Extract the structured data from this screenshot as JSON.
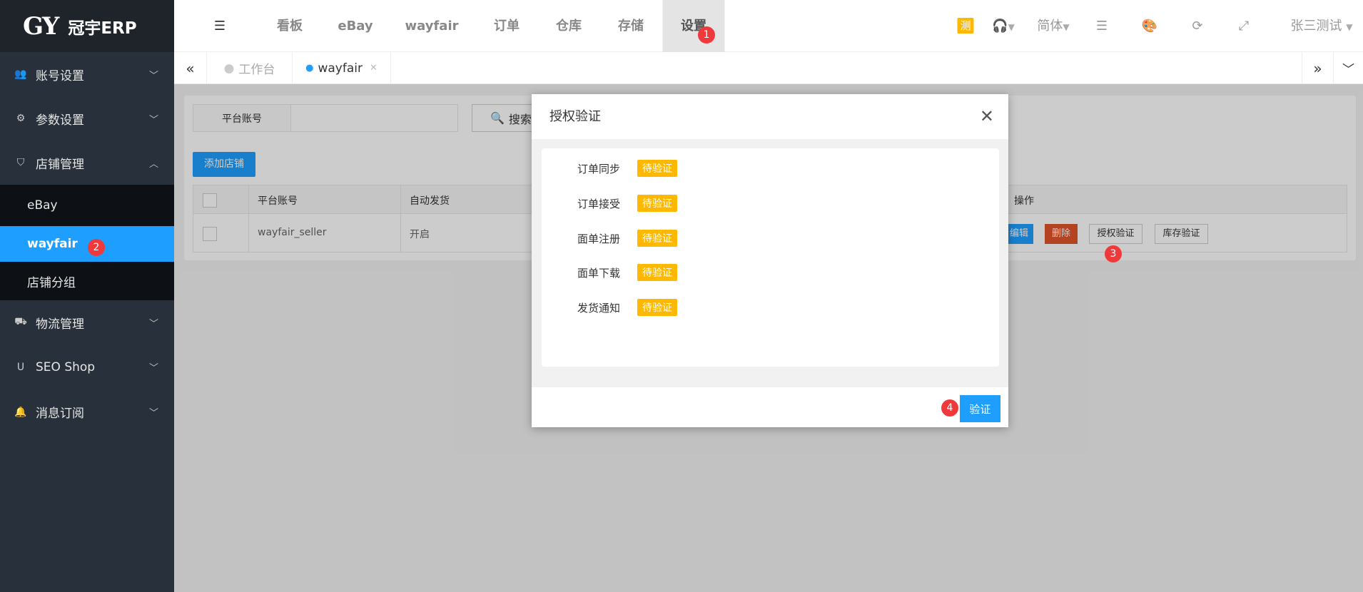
{
  "app": {
    "logo": "GY",
    "name": "冠宇ERP"
  },
  "topnav": {
    "items": [
      "看板",
      "eBay",
      "wayfair",
      "订单",
      "仓库",
      "存储",
      "设置"
    ],
    "active": "设置"
  },
  "topright": {
    "test_badge": "测",
    "language": "简体",
    "user": "张三测试"
  },
  "tabs": [
    {
      "label": "工作台"
    },
    {
      "label": "wayfair"
    }
  ],
  "sidebar": {
    "items": [
      {
        "label": "账号设置",
        "icon": "users-icon"
      },
      {
        "label": "参数设置",
        "icon": "gear-icon"
      },
      {
        "label": "店铺管理",
        "icon": "shield-icon"
      },
      {
        "label": "eBay"
      },
      {
        "label": "wayfair"
      },
      {
        "label": "店铺分组"
      },
      {
        "label": "物流管理",
        "icon": "truck-icon"
      },
      {
        "label": "SEO Shop",
        "icon": "magnet-icon"
      },
      {
        "label": "消息订阅",
        "icon": "bell-icon"
      }
    ]
  },
  "search": {
    "label": "平台账号",
    "value": "",
    "button": "搜索"
  },
  "add_button": "添加店铺",
  "table": {
    "headers": [
      "平台账号",
      "自动发货",
      "操作"
    ],
    "rows": [
      {
        "account": "wayfair_seller",
        "auto_ship": "开启",
        "actions": [
          "编辑",
          "删除",
          "授权验证",
          "库存验证"
        ]
      }
    ]
  },
  "modal": {
    "title": "授权验证",
    "rows": [
      {
        "label": "订单同步",
        "status": "待验证"
      },
      {
        "label": "订单接受",
        "status": "待验证"
      },
      {
        "label": "面单注册",
        "status": "待验证"
      },
      {
        "label": "面单下载",
        "status": "待验证"
      },
      {
        "label": "发货通知",
        "status": "待验证"
      }
    ],
    "confirm": "验证"
  },
  "markers": [
    "1",
    "2",
    "3",
    "4"
  ],
  "colors": {
    "accent": "#1e9fff",
    "warning": "#ffb800",
    "danger": "#e0542a",
    "sidebar": "#28313b"
  }
}
